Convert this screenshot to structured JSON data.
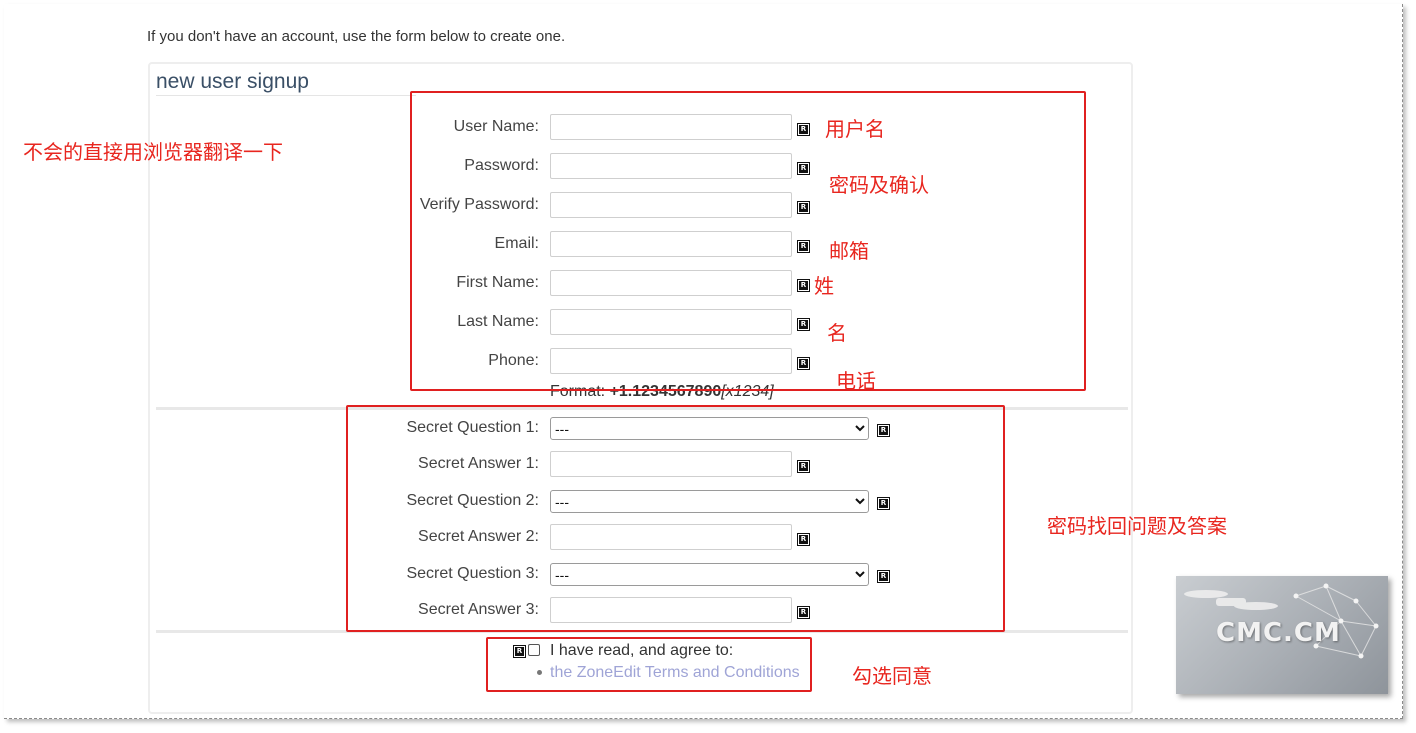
{
  "intro_text": "If you don't have an account, use the form below to create one.",
  "panel_title": "new user signup",
  "required_marker": "R",
  "fields": [
    {
      "label": "User Name:",
      "value": ""
    },
    {
      "label": "Password:",
      "value": ""
    },
    {
      "label": "Verify Password:",
      "value": ""
    },
    {
      "label": "Email:",
      "value": ""
    },
    {
      "label": "First Name:",
      "value": ""
    },
    {
      "label": "Last Name:",
      "value": ""
    },
    {
      "label": "Phone:",
      "value": ""
    }
  ],
  "phone_hint": {
    "prefix": "Format: ",
    "example": "+1.1234567890",
    "ext": "[x1234]"
  },
  "secret": [
    {
      "question_label": "Secret Question 1:",
      "selected": "---",
      "answer_label": "Secret Answer 1:",
      "answer_value": ""
    },
    {
      "question_label": "Secret Question 2:",
      "selected": "---",
      "answer_label": "Secret Answer 2:",
      "answer_value": ""
    },
    {
      "question_label": "Secret Question 3:",
      "selected": "---",
      "answer_label": "Secret Answer 3:",
      "answer_value": ""
    }
  ],
  "agree": {
    "label": "I have read, and agree to:",
    "link": "the ZoneEdit Terms and Conditions",
    "checked": false
  },
  "annotations": {
    "translate": "不会的直接用浏览器翻译一下",
    "username": "用户名",
    "password": "密码及确认",
    "email": "邮箱",
    "first_name": "姓",
    "last_name": "名",
    "phone": "电话",
    "secret": "密码找回问题及答案",
    "agree": "勾选同意"
  },
  "watermark": {
    "text": "CMC.CM"
  },
  "colors": {
    "annotation": "#e02020",
    "link": "#9fa4d6",
    "title": "#3a4f66"
  }
}
